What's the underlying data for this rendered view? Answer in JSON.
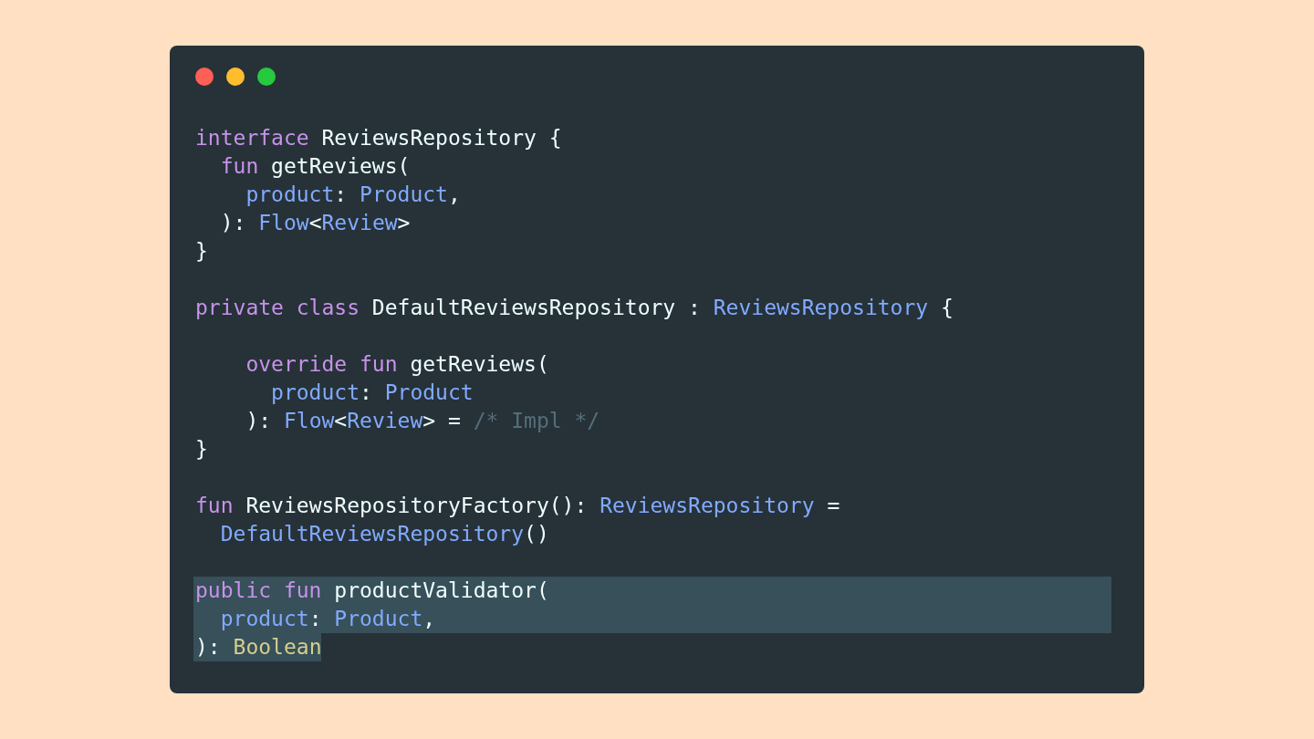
{
  "code_window": {
    "blocks": [
      {
        "lines": [
          {
            "selected": false,
            "tokens": [
              {
                "kind": "keyword",
                "text": "interface"
              },
              {
                "kind": "plain",
                "text": " ReviewsRepository {"
              }
            ]
          },
          {
            "selected": false,
            "tokens": [
              {
                "kind": "keyword",
                "text": "  fun"
              },
              {
                "kind": "plain",
                "text": " getReviews("
              }
            ]
          },
          {
            "selected": false,
            "tokens": [
              {
                "kind": "type",
                "text": "    product"
              },
              {
                "kind": "plain",
                "text": ": "
              },
              {
                "kind": "type",
                "text": "Product"
              },
              {
                "kind": "plain",
                "text": ","
              }
            ]
          },
          {
            "selected": false,
            "tokens": [
              {
                "kind": "plain",
                "text": "  ): "
              },
              {
                "kind": "type",
                "text": "Flow"
              },
              {
                "kind": "plain",
                "text": "<"
              },
              {
                "kind": "type",
                "text": "Review"
              },
              {
                "kind": "plain",
                "text": ">"
              }
            ]
          },
          {
            "selected": false,
            "tokens": [
              {
                "kind": "plain",
                "text": "}"
              }
            ]
          }
        ]
      },
      {
        "lines": [
          {
            "selected": false,
            "tokens": [
              {
                "kind": "keyword",
                "text": "private class"
              },
              {
                "kind": "plain",
                "text": " DefaultReviewsRepository : "
              },
              {
                "kind": "type",
                "text": "ReviewsRepository"
              },
              {
                "kind": "plain",
                "text": " {"
              }
            ]
          }
        ]
      },
      {
        "lines": [
          {
            "selected": false,
            "tokens": [
              {
                "kind": "keyword",
                "text": "    override fun"
              },
              {
                "kind": "plain",
                "text": " getReviews("
              }
            ]
          },
          {
            "selected": false,
            "tokens": [
              {
                "kind": "type",
                "text": "      product"
              },
              {
                "kind": "plain",
                "text": ": "
              },
              {
                "kind": "type",
                "text": "Product"
              }
            ]
          },
          {
            "selected": false,
            "tokens": [
              {
                "kind": "plain",
                "text": "    ): "
              },
              {
                "kind": "type",
                "text": "Flow"
              },
              {
                "kind": "plain",
                "text": "<"
              },
              {
                "kind": "type",
                "text": "Review"
              },
              {
                "kind": "plain",
                "text": "> = "
              },
              {
                "kind": "comment",
                "text": "/* Impl */"
              }
            ]
          },
          {
            "selected": false,
            "tokens": [
              {
                "kind": "plain",
                "text": "}"
              }
            ]
          }
        ]
      },
      {
        "lines": [
          {
            "selected": false,
            "tokens": [
              {
                "kind": "keyword",
                "text": "fun"
              },
              {
                "kind": "plain",
                "text": " ReviewsRepositoryFactory(): "
              },
              {
                "kind": "type",
                "text": "ReviewsRepository"
              },
              {
                "kind": "plain",
                "text": " ="
              }
            ]
          },
          {
            "selected": false,
            "tokens": [
              {
                "kind": "type",
                "text": "  DefaultReviewsRepository"
              },
              {
                "kind": "plain",
                "text": "()"
              }
            ]
          }
        ]
      },
      {
        "lines": [
          {
            "selected": true,
            "tokens": [
              {
                "kind": "keyword",
                "text": "public fun"
              },
              {
                "kind": "plain",
                "text": " productValidator("
              }
            ]
          },
          {
            "selected": true,
            "tokens": [
              {
                "kind": "type",
                "text": "  product"
              },
              {
                "kind": "plain",
                "text": ": "
              },
              {
                "kind": "type",
                "text": "Product"
              },
              {
                "kind": "plain",
                "text": ","
              }
            ]
          },
          {
            "selected": true,
            "tokens": [
              {
                "kind": "plain",
                "text": "): "
              },
              {
                "kind": "builtin",
                "text": "Boolean"
              }
            ]
          }
        ]
      }
    ]
  }
}
